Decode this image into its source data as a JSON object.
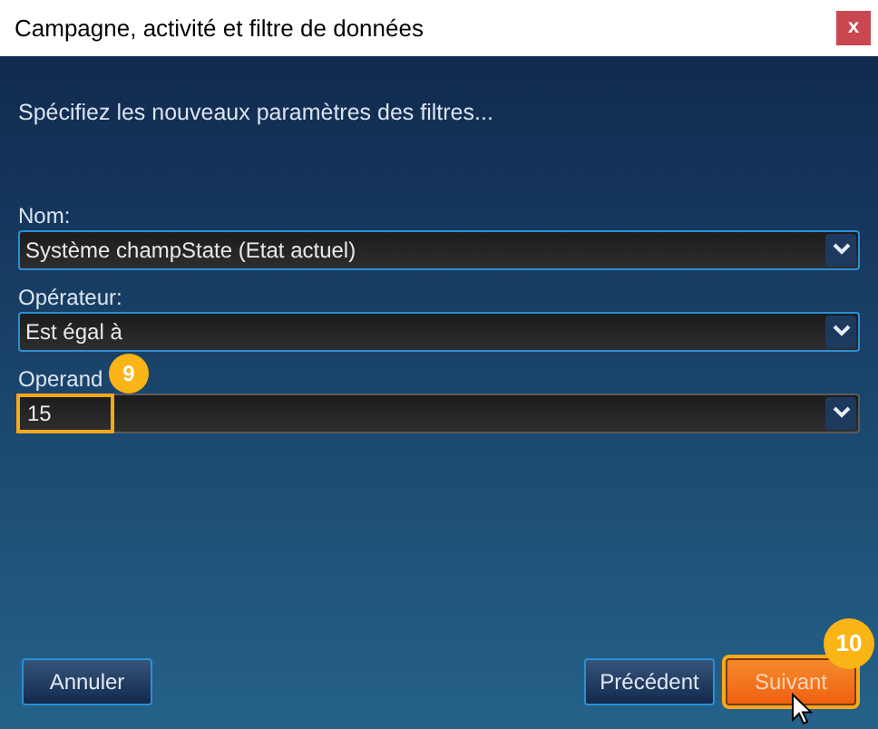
{
  "window": {
    "title": "Campagne, activité et filtre de données",
    "close": "x"
  },
  "instruction": "Spécifiez les nouveaux paramètres des filtres...",
  "fields": [
    {
      "label": "Nom:",
      "value": "Système champState (Etat actuel)",
      "active": true,
      "highlighted": false
    },
    {
      "label": "Opérateur:",
      "value": "Est égal à",
      "active": true,
      "highlighted": false
    },
    {
      "label": "Operand",
      "value": "15",
      "active": false,
      "highlighted": true,
      "step_badge": "9"
    }
  ],
  "buttons": [
    {
      "label": "Annuler",
      "kind": "secondary",
      "highlighted": false
    },
    {
      "label": "Précédent",
      "kind": "secondary",
      "highlighted": false
    },
    {
      "label": "Suivant",
      "kind": "primary",
      "highlighted": true,
      "step_badge": "10"
    }
  ]
}
